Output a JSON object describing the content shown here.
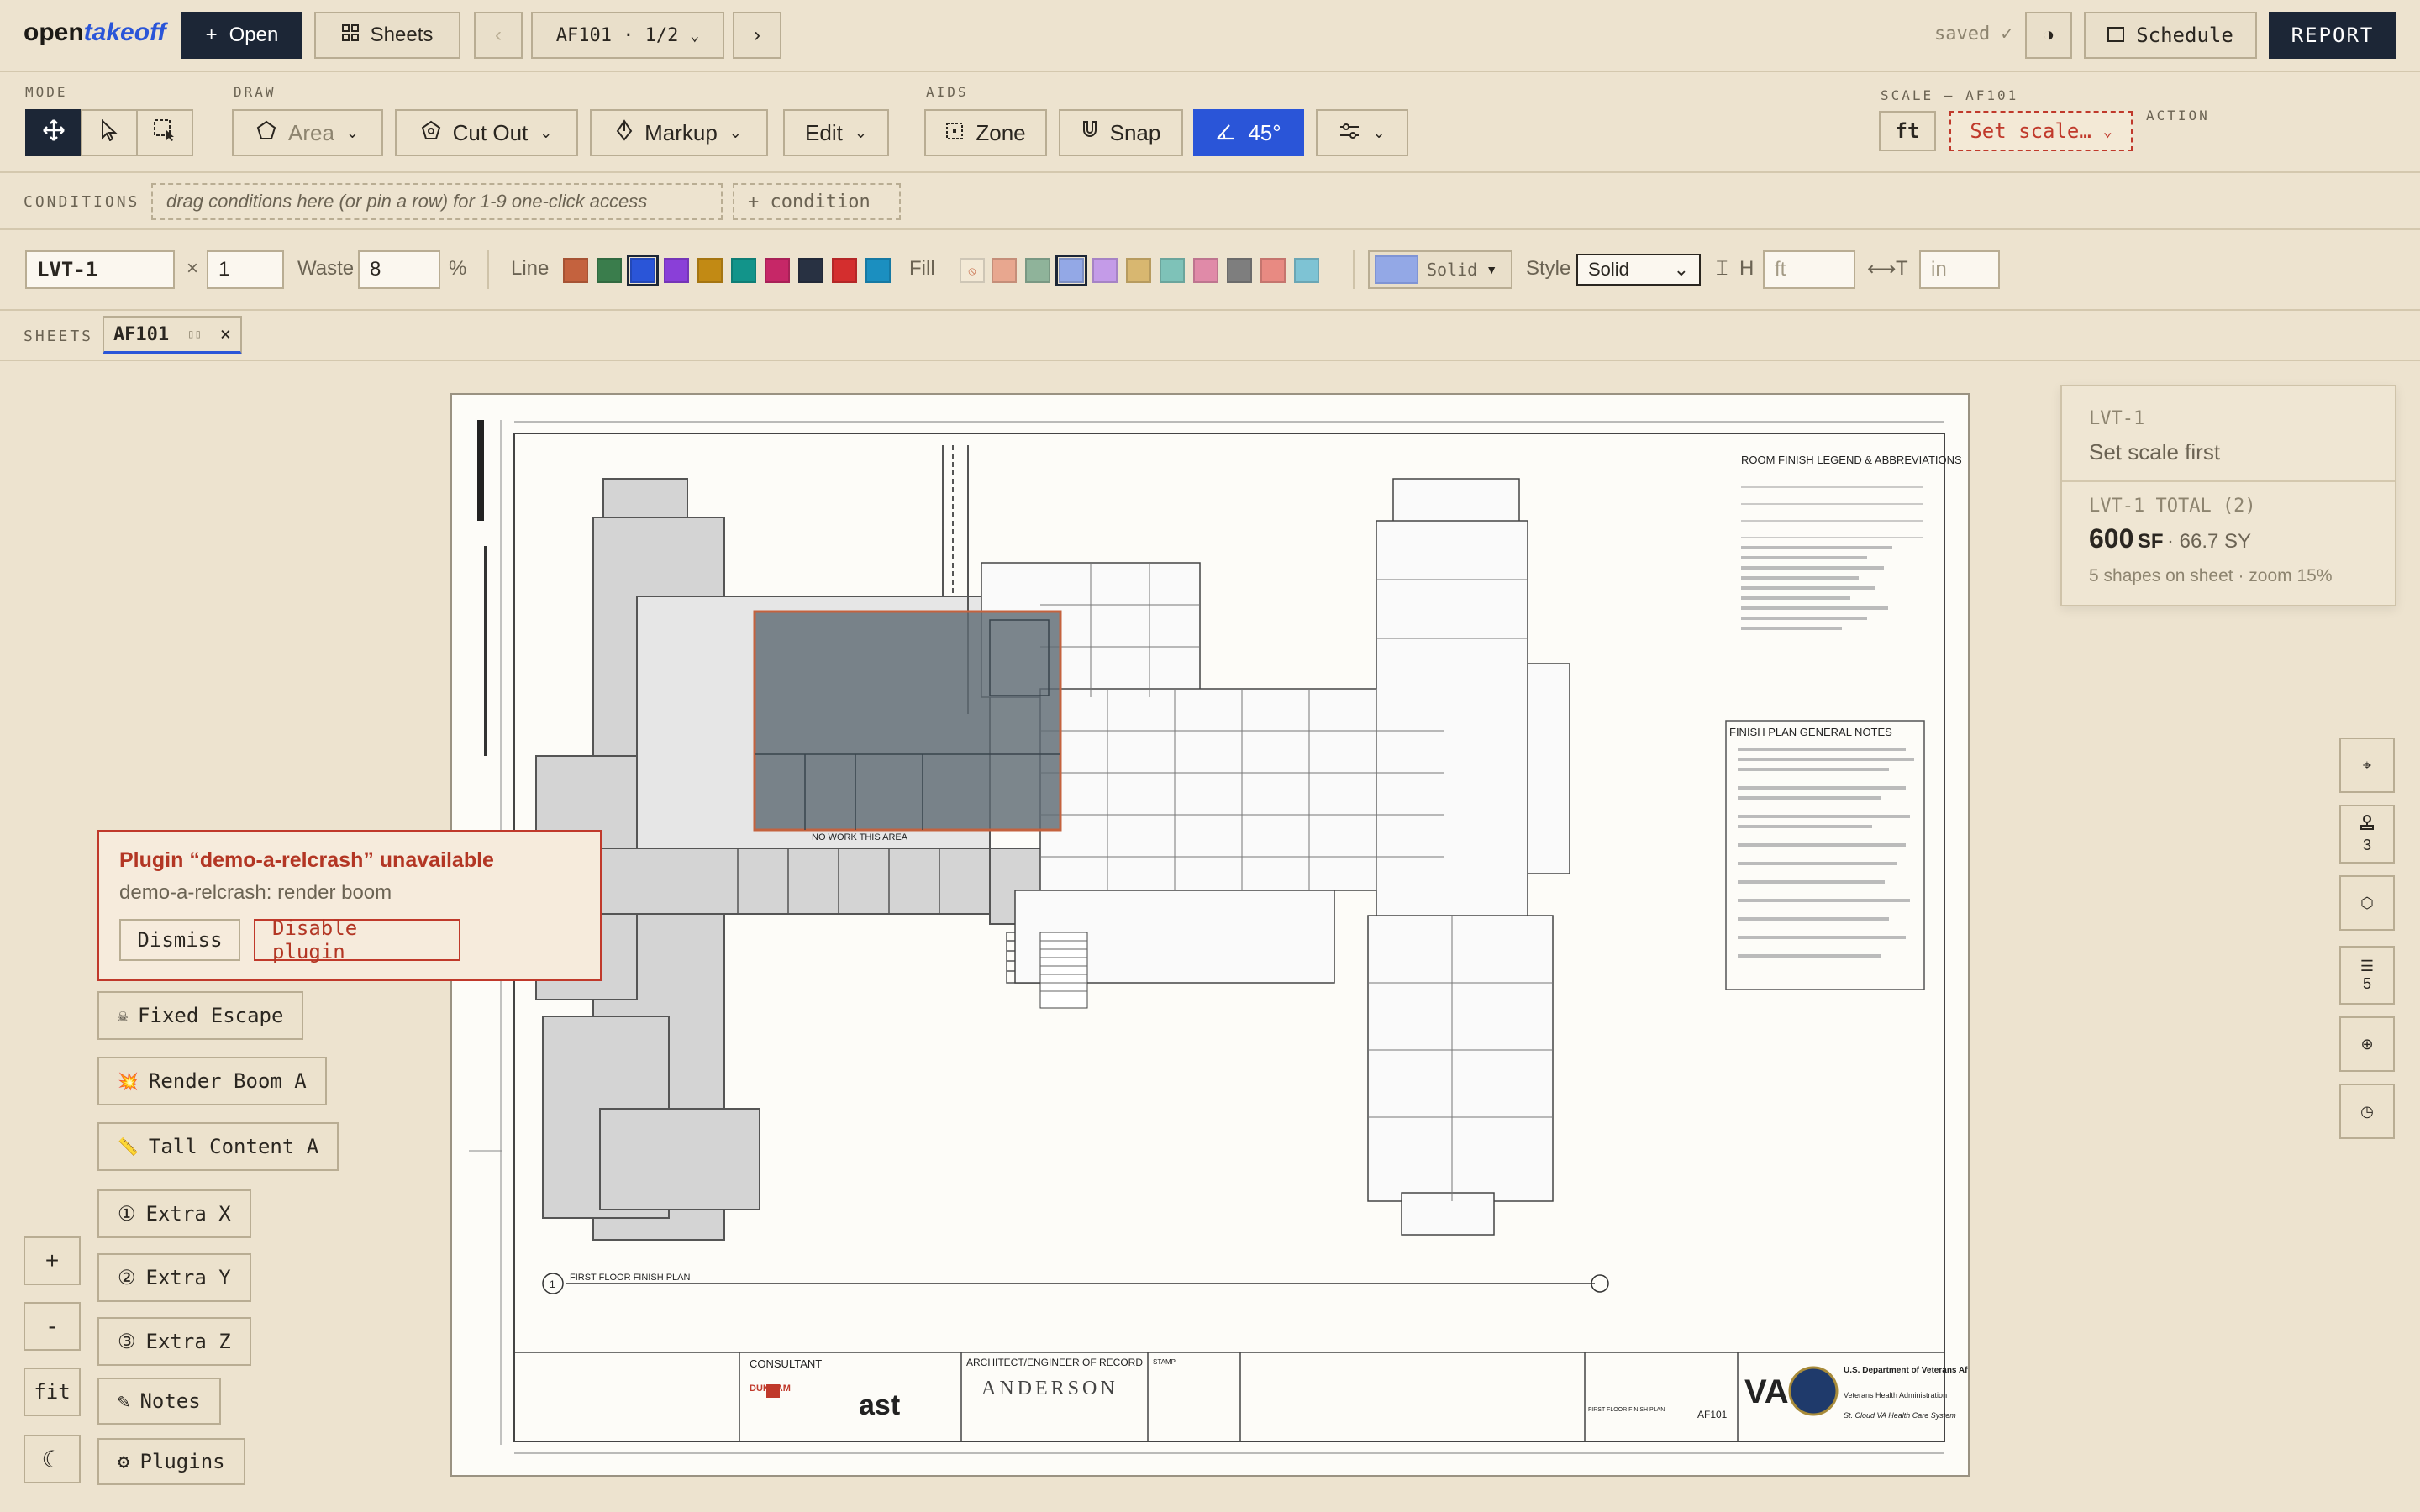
{
  "app": {
    "logo_plain": "open",
    "logo_accent": "takeoff"
  },
  "topbar": {
    "open_label": "Open",
    "sheets_label": "Sheets",
    "sheet_selector": "AF101 · 1/2",
    "saved_label": "saved ✓",
    "schedule_label": "Schedule",
    "report_label": "REPORT"
  },
  "toolbar": {
    "mode_label": "MODE",
    "draw_label": "DRAW",
    "aids_label": "AIDS",
    "scale_label": "SCALE — AF101",
    "action_label": "ACTION",
    "area_label": "Area",
    "cutout_label": "Cut Out",
    "markup_label": "Markup",
    "edit_label": "Edit",
    "zone_label": "Zone",
    "snap_label": "Snap",
    "angle_label": "45°",
    "unit_label": "ft",
    "set_scale_label": "Set scale…"
  },
  "conditions": {
    "label": "CONDITIONS",
    "dropzone_text": "drag conditions here (or pin a row) for 1-9 one-click access",
    "add_label": "+ condition"
  },
  "props": {
    "name_value": "LVT-1",
    "multiplier_symbol": "×",
    "multiplier_value": "1",
    "waste_label": "Waste",
    "waste_value": "8",
    "waste_unit": "%",
    "line_label": "Line",
    "fill_label": "Fill",
    "line_colors": [
      "#c4623e",
      "#3a7d4c",
      "#2a55d8",
      "#8a3fd8",
      "#c28a14",
      "#12948a",
      "#c62767",
      "#283142",
      "#d42e2e",
      "#1b8fc0"
    ],
    "fill_colors": [
      "#e8a78f",
      "#8fb39a",
      "#93a8e6",
      "#c49be8",
      "#d8b770",
      "#7ec2b8",
      "#e08aa8",
      "#7e7e7e",
      "#e88a82",
      "#7ec3d4"
    ],
    "fill_pattern_label": "Solid",
    "style_label": "Style",
    "style_value": "Solid",
    "height_label": "H",
    "height_placeholder": "ft",
    "thickness_label": "T",
    "thickness_placeholder": "in"
  },
  "sheets": {
    "label": "SHEETS",
    "active_tab": "AF101"
  },
  "drawing": {
    "legend_title": "ROOM FINISH LEGEND & ABBREVIATIONS",
    "notes_title": "FINISH PLAN GENERAL NOTES",
    "no_work_label": "NO WORK THIS AREA",
    "plan_title": "FIRST FLOOR FINISH PLAN",
    "plan_number": "1",
    "consultant_label": "CONSULTANT",
    "architect_label": "ARCHITECT/ENGINEER OF RECORD",
    "stamp_label": "STAMP",
    "dunham_label": "DUNHAM",
    "ast_label": "ast",
    "anderson_label": "ANDERSON",
    "va_label": "VA",
    "va_dept": "U.S. Department of Veterans Affairs",
    "va_sub": "Veterans Health Administration",
    "va_site": "St. Cloud VA Health Care System",
    "drawing_number": "AF101",
    "drawing_title": "FIRST FLOOR FINISH PLAN"
  },
  "summary": {
    "condition_name": "LVT-1",
    "status": "Set scale first",
    "total_label": "LVT-1 TOTAL (2)",
    "total_value": "600",
    "total_unit": "SF",
    "total_secondary": "· 66.7 SY",
    "footer": "5 shapes on sheet · zoom 15%"
  },
  "rail": {
    "layers_count": "3",
    "list_count": "5"
  },
  "zoom": {
    "in": "+",
    "out": "-",
    "fit": "fit",
    "theme": "☾"
  },
  "error": {
    "title": "Plugin “demo-a-relcrash” unavailable",
    "message": "demo-a-relcrash: render boom",
    "dismiss_label": "Dismiss",
    "disable_label": "Disable plugin"
  },
  "plugins": {
    "fixed_escape": "Fixed Escape",
    "render_boom": "Render Boom A",
    "tall_content": "Tall Content A",
    "extra_x": "Extra X",
    "extra_y": "Extra Y",
    "extra_z": "Extra Z",
    "notes": "Notes",
    "plugins": "Plugins"
  },
  "icons": {
    "fixed_escape": "☠",
    "render_boom": "💥",
    "tall_content": "📏",
    "extra_x": "①",
    "extra_y": "②",
    "extra_z": "③",
    "notes": "✎",
    "plugins": "⚙"
  },
  "colors": {
    "accent": "#2a55d8",
    "dark": "#1c2636",
    "error": "#c0392b",
    "background": "#ede3cf"
  }
}
